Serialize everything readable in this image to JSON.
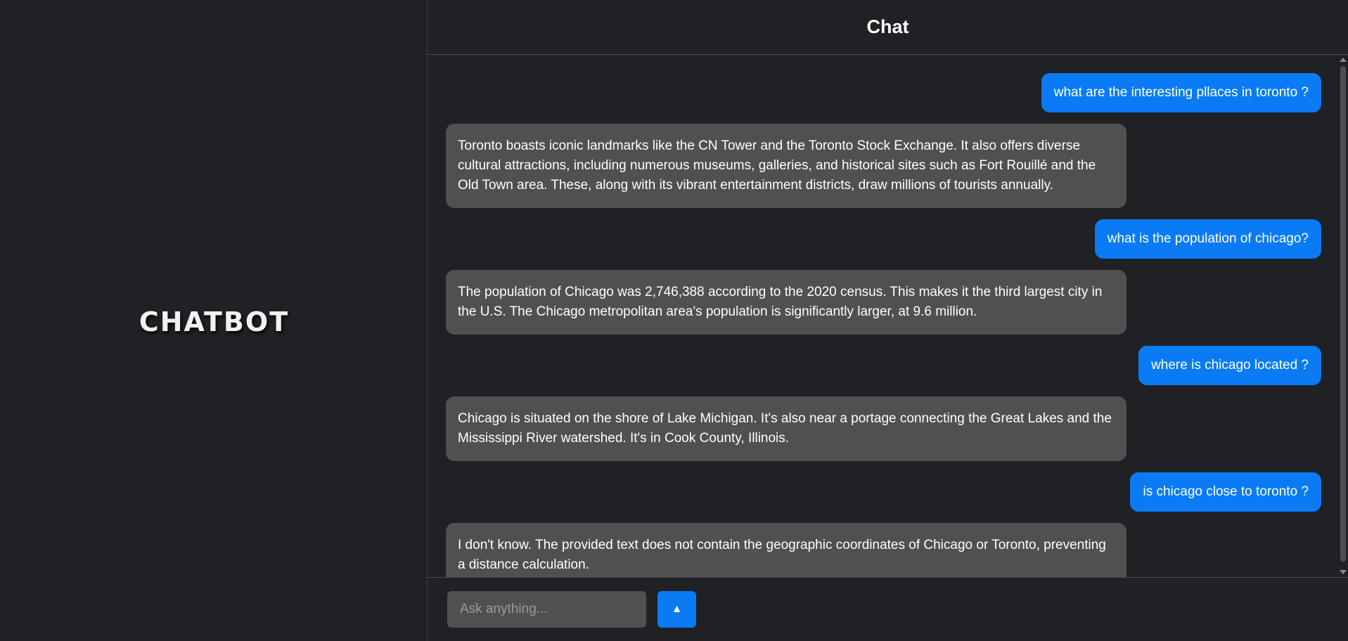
{
  "sidebar": {
    "brand": "CHATBOT"
  },
  "header": {
    "title": "Chat"
  },
  "messages": [
    {
      "role": "user",
      "text": "what are the interesting pllaces in toronto ?"
    },
    {
      "role": "bot",
      "text": "Toronto boasts iconic landmarks like the CN Tower and the Toronto Stock Exchange. It also offers diverse cultural attractions, including numerous museums, galleries, and historical sites such as Fort Rouillé and the Old Town area. These, along with its vibrant entertainment districts, draw millions of tourists annually."
    },
    {
      "role": "user",
      "text": "what is the population of chicago?"
    },
    {
      "role": "bot",
      "text": "The population of Chicago was 2,746,388 according to the 2020 census. This makes it the third largest city in the U.S. The Chicago metropolitan area's population is significantly larger, at 9.6 million."
    },
    {
      "role": "user",
      "text": "where is chicago located ?"
    },
    {
      "role": "bot",
      "text": "Chicago is situated on the shore of Lake Michigan. It's also near a portage connecting the Great Lakes and the Mississippi River watershed. It's in Cook County, Illinois."
    },
    {
      "role": "user",
      "text": "is chicago close to toronto ?"
    },
    {
      "role": "bot",
      "text": "I don't know. The provided text does not contain the geographic coordinates of Chicago or Toronto, preventing a distance calculation."
    }
  ],
  "composer": {
    "placeholder": "Ask anything...",
    "value": "",
    "send_icon": "▲"
  },
  "colors": {
    "background": "#202124",
    "user_bubble": "#0a7bf5",
    "bot_bubble": "#4f5052",
    "accent": "#0a7bf5"
  }
}
